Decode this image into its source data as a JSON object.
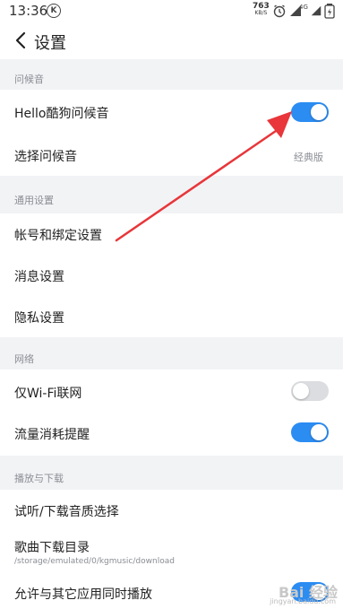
{
  "status_bar": {
    "time": "13:36",
    "app_badge": "K",
    "net_speed": "763",
    "net_unit": "KB/S",
    "network": "4G"
  },
  "header": {
    "title": "设置"
  },
  "sections": {
    "greeting": {
      "title": "问候音",
      "hello_label": "Hello酷狗问候音",
      "hello_on": true,
      "choose_label": "选择问候音",
      "choose_value": "经典版"
    },
    "general": {
      "title": "通用设置",
      "account_label": "帐号和绑定设置",
      "message_label": "消息设置",
      "privacy_label": "隐私设置"
    },
    "network": {
      "title": "网络",
      "wifi_only_label": "仅Wi-Fi联网",
      "wifi_only_on": false,
      "traffic_label": "流量消耗提醒",
      "traffic_on": true
    },
    "playback": {
      "title": "播放与下载",
      "quality_label": "试听/下载音质选择",
      "dir_label": "歌曲下载目录",
      "dir_path": "/storage/emulated/0/kgmusic/download",
      "concurrent_label": "允许与其它应用同时播放",
      "concurrent_on": true
    }
  },
  "colors": {
    "accent": "#2b8cf2",
    "arrow": "#e8363a"
  },
  "watermark": {
    "text": "Bai 经验",
    "sub": "jingyan.baidu.com"
  }
}
